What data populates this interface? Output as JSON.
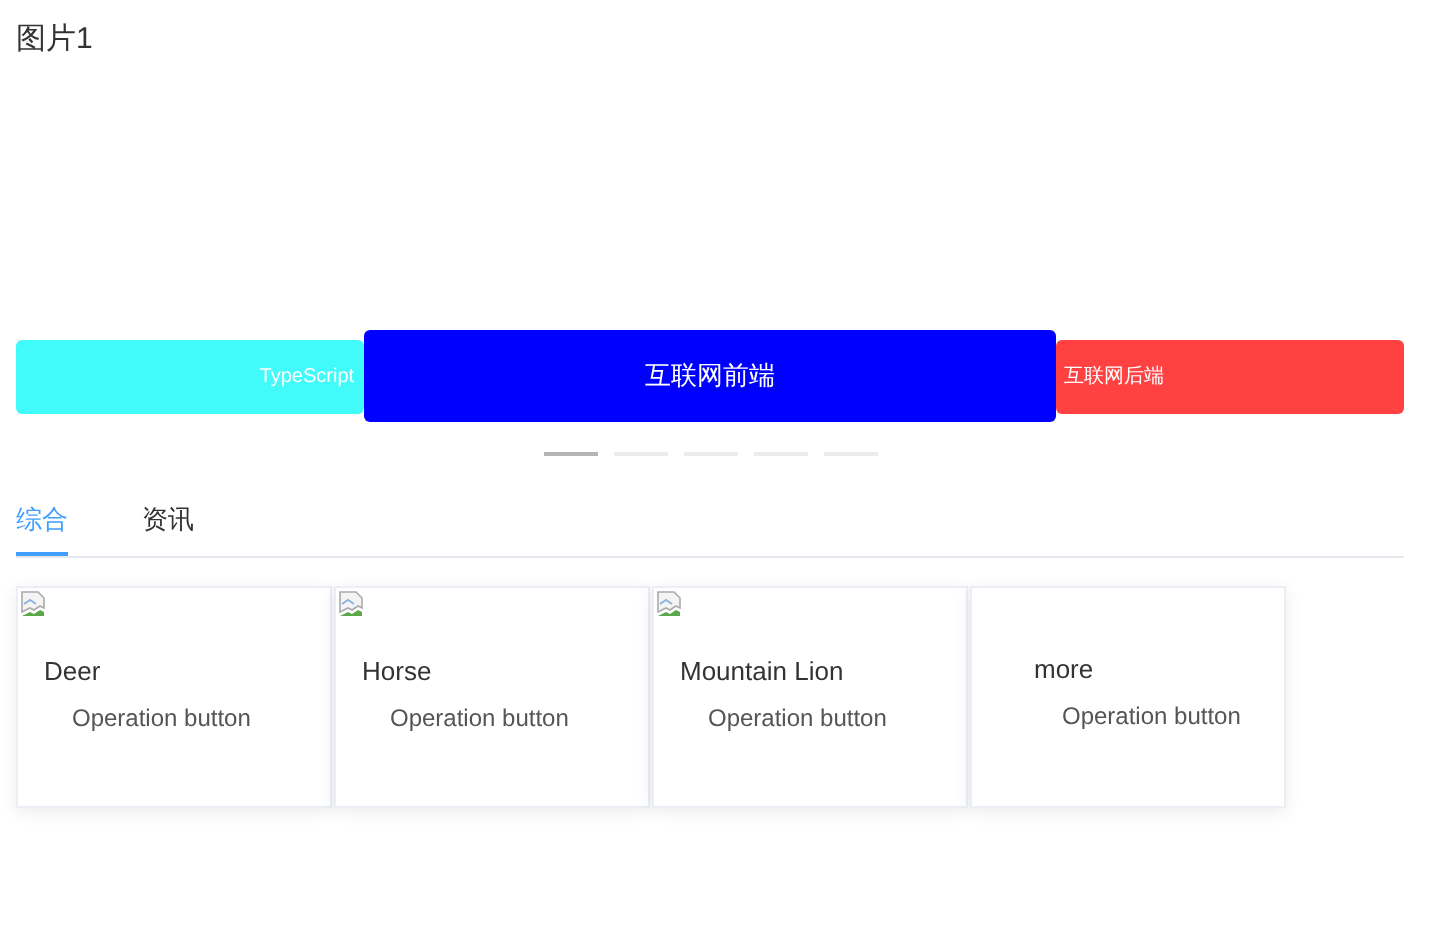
{
  "title": "图片1",
  "carousel": {
    "slides": [
      {
        "label": "TypeScript",
        "color": "#41fafa",
        "selected": false
      },
      {
        "label": "互联网前端",
        "color": "#0000ff",
        "selected": true
      },
      {
        "label": "互联网后端",
        "color": "#ff4141",
        "selected": false
      }
    ],
    "indicators": [
      {
        "selected": true
      },
      {
        "selected": false
      },
      {
        "selected": false
      },
      {
        "selected": false
      },
      {
        "selected": false
      }
    ]
  },
  "tabs": [
    {
      "label": "综合",
      "selected": true
    },
    {
      "label": "资讯",
      "selected": false
    }
  ],
  "cards": [
    {
      "kind": "image",
      "name": "Deer",
      "action": "Operation button"
    },
    {
      "kind": "image",
      "name": "Horse",
      "action": "Operation button"
    },
    {
      "kind": "image",
      "name": "Mountain Lion",
      "action": "Operation button"
    },
    {
      "kind": "more",
      "name": "more",
      "action": "Operation button"
    }
  ]
}
